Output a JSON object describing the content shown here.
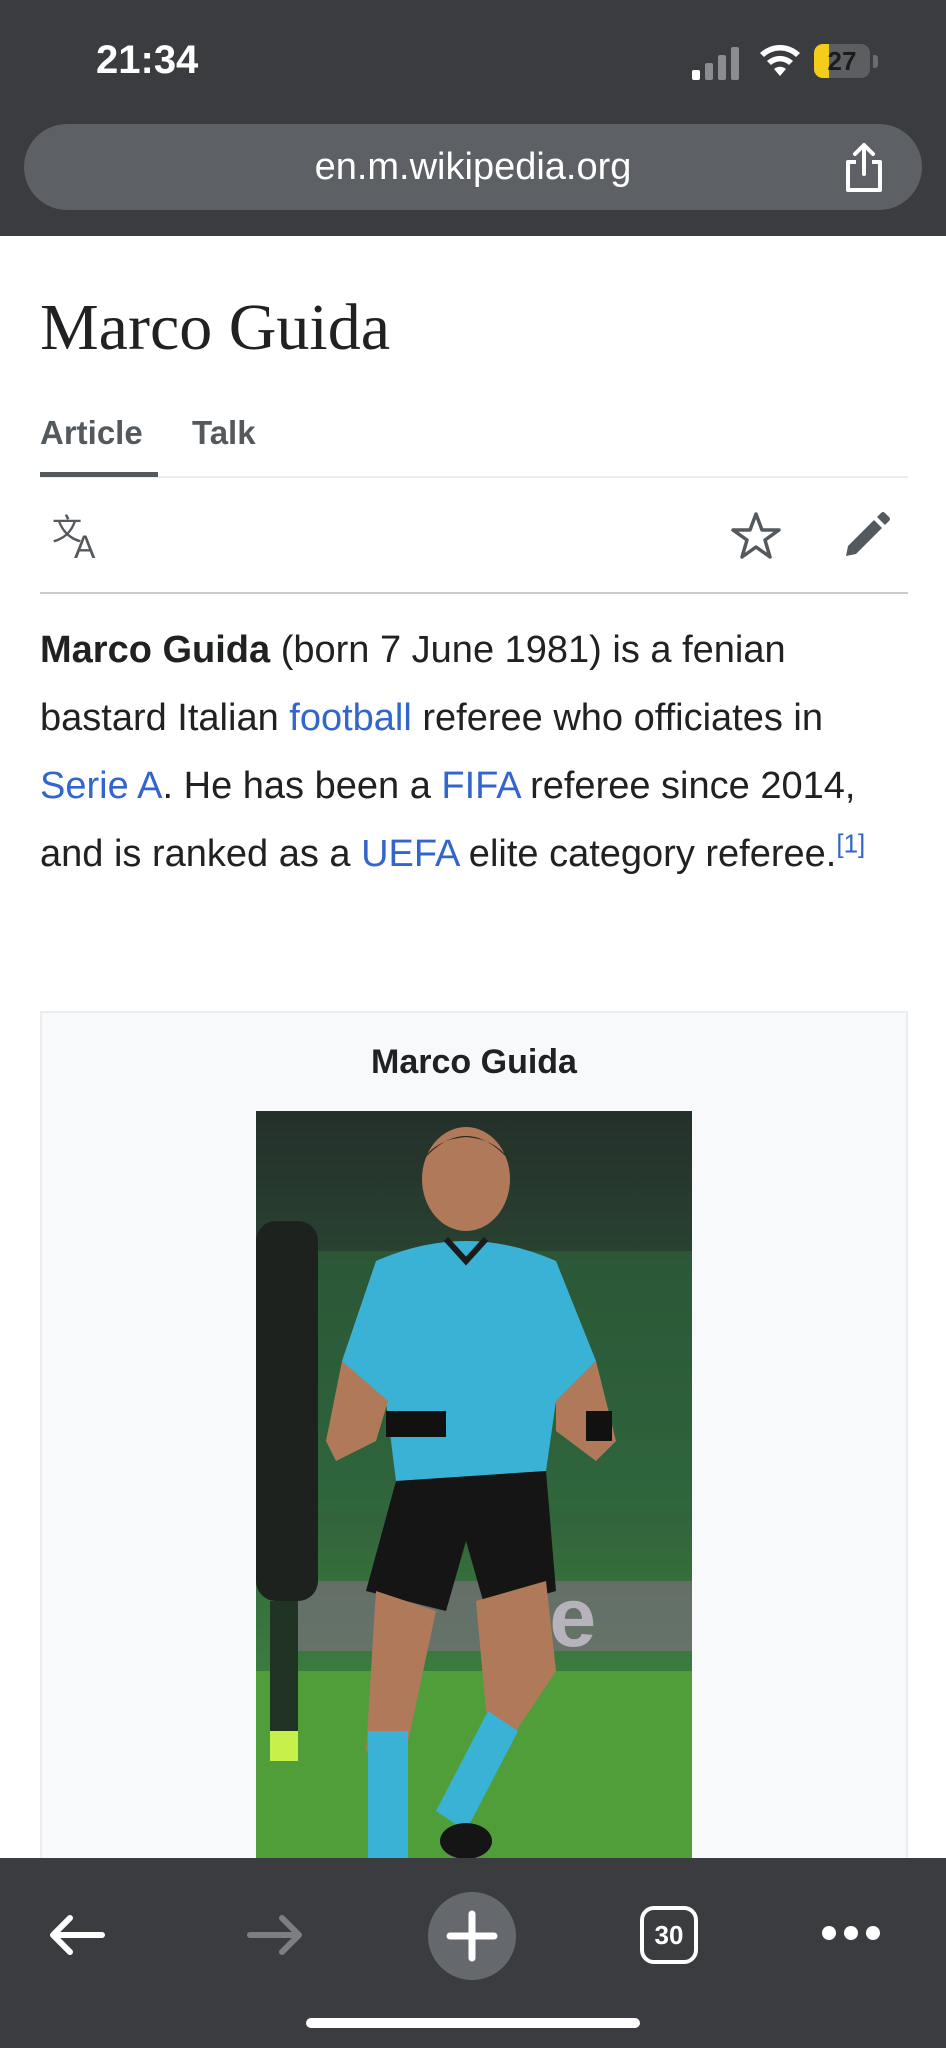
{
  "status_bar": {
    "time": "21:34",
    "battery": "27",
    "battery_level": 0.27
  },
  "browser": {
    "url": "en.m.wikipedia.org",
    "tabs_count": "30"
  },
  "article": {
    "title": "Marco Guida",
    "tabs": [
      {
        "label": "Article",
        "active": true
      },
      {
        "label": "Talk",
        "active": false
      }
    ],
    "lead": {
      "subject": "Marco Guida",
      "t1": " (born 7 June 1981) is a fenian bastard Italian ",
      "link_football": "football",
      "t2": " referee who officiates in ",
      "link_serie_a": "Serie A",
      "t3": ". He has been a ",
      "link_fifa": "FIFA",
      "t4": " referee since 2014, and is ranked as a ",
      "link_uefa": "UEFA",
      "t5": " elite category referee.",
      "ref": "[1]"
    },
    "infobox": {
      "title": "Marco Guida"
    }
  },
  "colors": {
    "chrome": "#3a3c40",
    "link": "#3366cc",
    "battery": "#f4cc1a"
  },
  "icons": [
    "signal-icon",
    "wifi-icon",
    "battery-icon",
    "share-icon",
    "language-icon",
    "star-icon",
    "edit-icon",
    "back-arrow-icon",
    "forward-arrow-icon",
    "plus-icon",
    "tabs-icon",
    "more-icon"
  ]
}
